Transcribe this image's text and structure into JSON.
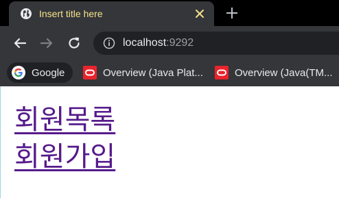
{
  "tab": {
    "title": "Insert title here",
    "favicon": "globe-icon",
    "close_icon": "close-icon"
  },
  "new_tab_icon": "plus-icon",
  "toolbar": {
    "back_icon": "arrow-left-icon",
    "forward_icon": "arrow-right-icon",
    "reload_icon": "reload-icon",
    "info_icon": "info-icon",
    "url_host": "localhost",
    "url_port": ":9292"
  },
  "bookmarks": [
    {
      "label": "Google",
      "icon": "google-icon"
    },
    {
      "label": "Overview (Java Plat...",
      "icon": "oracle-icon"
    },
    {
      "label": "Overview (Java(TM...",
      "icon": "oracle-icon"
    }
  ],
  "page": {
    "links": [
      {
        "label": "회원목록"
      },
      {
        "label": "회원가입"
      }
    ]
  },
  "colors": {
    "tab_title": "#f5e28a",
    "chrome_bg": "#35363a",
    "omnibox_bg": "#202124",
    "link_visited": "#551a8b",
    "oracle_red": "#e8242c"
  }
}
